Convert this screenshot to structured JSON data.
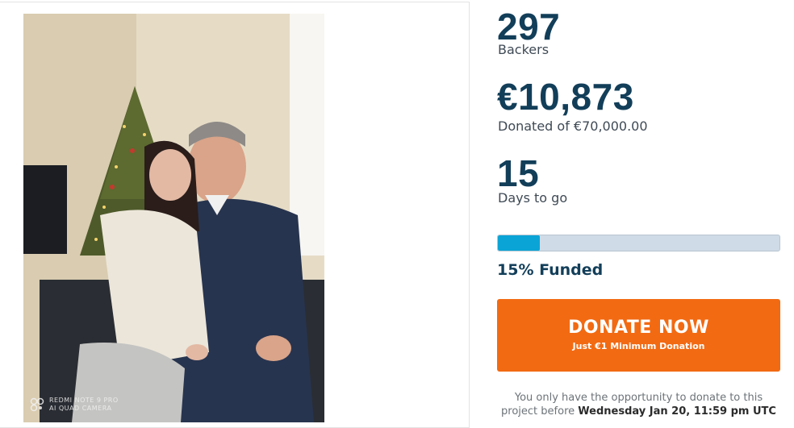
{
  "campaign_photo": {
    "watermark_line1": "REDMI NOTE 9 PRO",
    "watermark_line2": "AI QUAD CAMERA",
    "icon": "camera-watermark-icon"
  },
  "stats": {
    "backers_value": "297",
    "backers_label": "Backers",
    "donated_value": "€10,873",
    "donated_label": "Donated of €70,000.00",
    "days_value": "15",
    "days_label": "Days to go"
  },
  "progress": {
    "fraction": 0.15,
    "funded_label": "15% Funded"
  },
  "donate_button": {
    "label": "DONATE NOW",
    "sublabel": "Just €1 Minimum Donation"
  },
  "notice": {
    "text_prefix": "You only have the opportunity to donate to this project before",
    "deadline": "Wednesday Jan 20, 11:59 pm UTC"
  },
  "colors": {
    "accent": "#f26a12",
    "primary_text": "#123e59",
    "progress_fill": "#0aa4d6",
    "progress_track": "#cfdbe6"
  }
}
